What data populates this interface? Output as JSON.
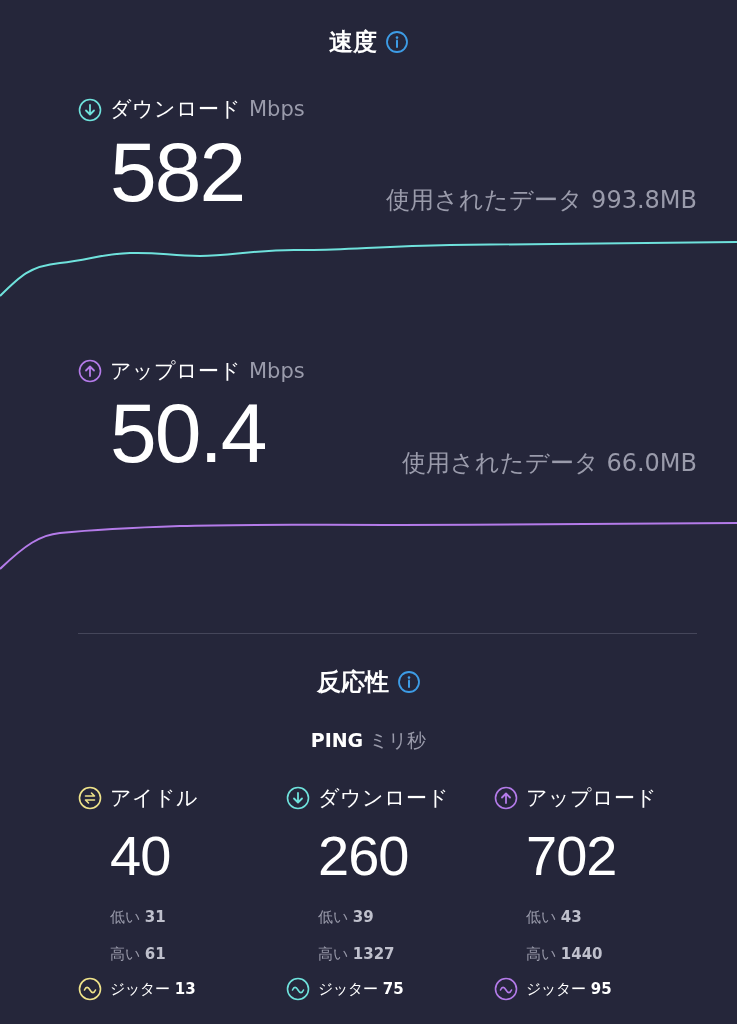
{
  "speed": {
    "title": "速度",
    "metrics": [
      {
        "kind": "download",
        "label": "ダウンロード",
        "unit": "Mbps",
        "value": "582",
        "data_text": "使用されたデータ 993.8MB"
      },
      {
        "kind": "upload",
        "label": "アップロード",
        "unit": "Mbps",
        "value": "50.4",
        "data_text": "使用されたデータ 66.0MB"
      }
    ]
  },
  "responsiveness": {
    "title": "反応性",
    "ping_label": "PING",
    "ping_unit": "ミリ秒",
    "columns": [
      {
        "kind": "idle",
        "label": "アイドル",
        "value": "40",
        "low": "低い **31**",
        "high": "高い **61**",
        "jitter": "ジッター **13**"
      },
      {
        "kind": "download",
        "label": "ダウンロード",
        "value": "260",
        "low": "低い **39**",
        "high": "高い **1327**",
        "jitter": "ジッター **75**"
      },
      {
        "kind": "upload",
        "label": "アップロード",
        "value": "702",
        "low": "低い **43**",
        "high": "高い **1440**",
        "jitter": "ジッター **95**"
      }
    ]
  }
}
